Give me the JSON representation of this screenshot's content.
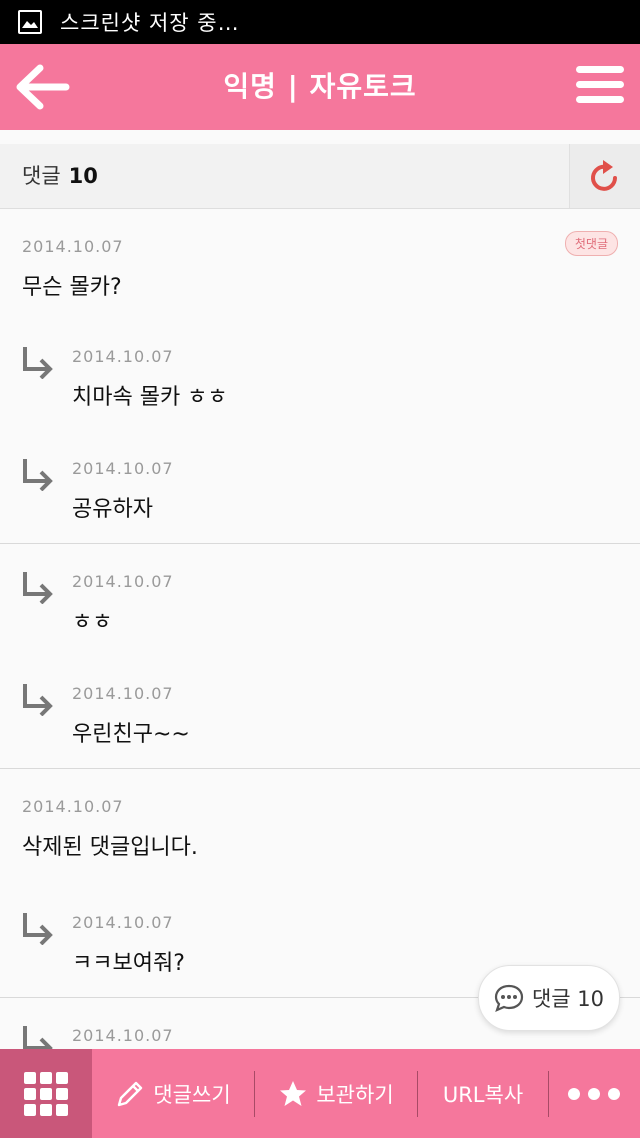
{
  "status_bar": {
    "text": "스크린샷 저장 중…",
    "icon": "image-icon"
  },
  "app_bar": {
    "title": "익명 | 자유토크",
    "back_icon": "arrow-left-icon",
    "menu_icon": "hamburger-menu-icon",
    "color": "#f5779c"
  },
  "comment_header": {
    "label": "댓글",
    "count": "10",
    "refresh_icon": "refresh-icon"
  },
  "groups": [
    {
      "top": {
        "date": "2014.10.07",
        "text": "무슨 몰카?",
        "badge": "첫댓글"
      },
      "replies": [
        {
          "date": "2014.10.07",
          "text": "치마속 몰카 ㅎㅎ"
        },
        {
          "date": "2014.10.07",
          "text": "공유하자"
        }
      ]
    },
    {
      "replies": [
        {
          "date": "2014.10.07",
          "text": "ㅎㅎ"
        },
        {
          "date": "2014.10.07",
          "text": "우린친구~~"
        }
      ]
    },
    {
      "top": {
        "date": "2014.10.07",
        "text": "삭제된 댓글입니다."
      },
      "replies": [
        {
          "date": "2014.10.07",
          "text": "ㅋㅋ보여줘?"
        }
      ]
    },
    {
      "replies": [
        {
          "date": "2014.10.07",
          "text": ""
        }
      ]
    }
  ],
  "float_button": {
    "label": "댓글 10",
    "icon": "chat-bubble-icon"
  },
  "bottom_bar": {
    "grid_icon": "grid-icon",
    "write_label": "댓글쓰기",
    "save_label": "보관하기",
    "url_label": "URL복사",
    "more_icon": "more-dots-icon"
  }
}
